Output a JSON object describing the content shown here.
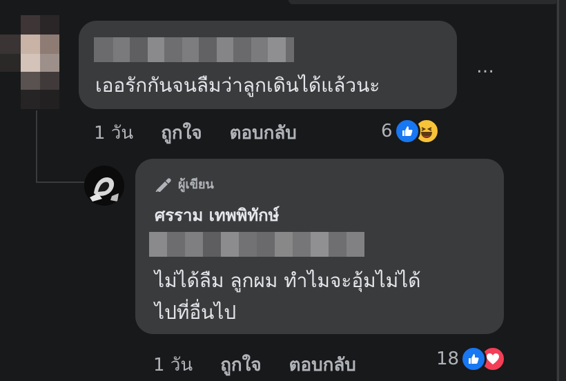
{
  "comment": {
    "text": "เออรักกันจนลืมว่าลูกเดินได้แล้วนะ",
    "more_label": "…",
    "actions": {
      "time": "1 วัน",
      "like": "ถูกใจ",
      "reply": "ตอบกลับ"
    },
    "reactions": {
      "count": "6",
      "types": [
        "like-icon",
        "haha-icon"
      ]
    }
  },
  "reply": {
    "author_tag": "ผู้เขียน",
    "author_name": "ศรราม เทพพิทักษ์",
    "text_line1": "ไม่ได้ลืม ลูกผม ทำไมจะอุ้มไม่ได้",
    "text_line2": "ไปที่อื่นไป",
    "actions": {
      "time": "1 วัน",
      "like": "ถูกใจ",
      "reply": "ตอบกลับ"
    },
    "reactions": {
      "count": "18",
      "types": [
        "like-icon",
        "love-icon"
      ]
    }
  },
  "colors": {
    "background": "#18191a",
    "bubble": "#3a3b3c",
    "primary_text": "#e4e6eb",
    "secondary_text": "#b0b3b8",
    "like_blue": "#1877f2",
    "love_red": "#f33e58",
    "haha_yellow": "#f7c339"
  }
}
